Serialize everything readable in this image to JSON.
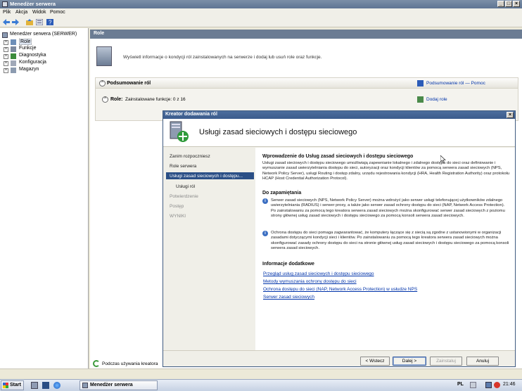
{
  "window": {
    "title": "Menedżer serwera",
    "buttons": [
      "_",
      "□",
      "×"
    ]
  },
  "menu": [
    "Plik",
    "Akcja",
    "Widok",
    "Pomoc"
  ],
  "toolbar": [
    "back-icon",
    "forward-icon",
    "up-icon",
    "properties-icon",
    "help-icon"
  ],
  "tree": {
    "root": "Menedżer serwera (SERWER)",
    "items": [
      "Role",
      "Funkcje",
      "Diagnostyka",
      "Konfiguracja",
      "Magazyn"
    ]
  },
  "main": {
    "header": "Role",
    "intro": "Wyświetl informacje o kondycji ról zainstalowanych na serwerze i dodaj lub usuń role oraz funkcje.",
    "summary_title": "Podsumowanie ról",
    "summary_help": "Podsumowanie ról — Pomoc",
    "roles_label": "Role:",
    "roles_value": "Zainstalowane funkcje: 0 z 16",
    "add_role": "Dodaj role"
  },
  "wizard": {
    "title": "Kreator dodawania ról",
    "heading": "Usługi zasad sieciowych i dostępu sieciowego",
    "nav": [
      "Zanim rozpoczniesz",
      "Role serwera",
      "Usługi zasad sieciowych i dostępu...",
      "Usługi ról",
      "Potwierdzenie",
      "Postęp",
      "WYNIKI"
    ],
    "section1_title": "Wprowadzenie do Usług zasad sieciowych i dostępu sieciowego",
    "section1_text": "Usługi zasad sieciowych i dostępu sieciowego umożliwiają zapewnianie lokalnego i zdalnego dostępu do sieci oraz definiowanie i wymuszanie zasad uwierzytelniania dostępu do sieci, autoryzacji oraz kondycji klientów za pomocą serwera zasad sieciowych (NPS, Network Policy Server), usługi Routing i dostęp zdalny, urzędu rejestrowania kondycji (HRA, Health Registration Authority) oraz protokołu HCAP (Host Credential Authorization Protocol).",
    "section2_title": "Do zapamiętania",
    "note1": "Serwer zasad sieciowych (NPS, Network Policy Server) można wdrożyć jako serwer usługi telefonującej użytkowników zdalnego uwierzytelniania (RADIUS) i serwer proxy, a także jako serwer zasad ochrony dostępu do sieci (NAP, Network Access Protection). Po zainstalowaniu za pomocą tego kreatora serwera zasad sieciowych można skonfigurować serwer zasad sieciowych z poziomu strony głównej usług zasad sieciowych i dostępu sieciowego za pomocą konsoli serwera zasad sieciowych.",
    "note2": "Ochrona dostępu do sieci pomaga zagwarantować, że komputery łączące się z siecią są zgodne z ustanowionymi w organizacji zasadami dotyczącymi kondycji sieci i klientów. Po zainstalowaniu za pomocą tego kreatora serwera zasad sieciowych można skonfigurować zasady ochrony dostępu do sieci na stronie głównej usług zasad sieciowych i dostępu sieciowego za pomocą konsoli serwera zasad sieciowych.",
    "section3_title": "Informacje dodatkowe",
    "links": [
      "Przegląd usług zasad sieciowych i dostępu sieciowego",
      "Metody wymuszania ochrony dostępu do sieci",
      "Ochrona dostępu do sieci (NAP, Network Access Protection) w usłudze NPS",
      "Serwer zasad sieciowych"
    ],
    "buttons": {
      "back": "< Wstecz",
      "next": "Dalej >",
      "install": "Zainstaluj",
      "cancel": "Anuluj"
    }
  },
  "status": {
    "text": "Podczas używania kreatora"
  },
  "taskbar": {
    "start": "Start",
    "task": "Menedżer serwera",
    "lang": "PL",
    "clock": "21:46"
  }
}
